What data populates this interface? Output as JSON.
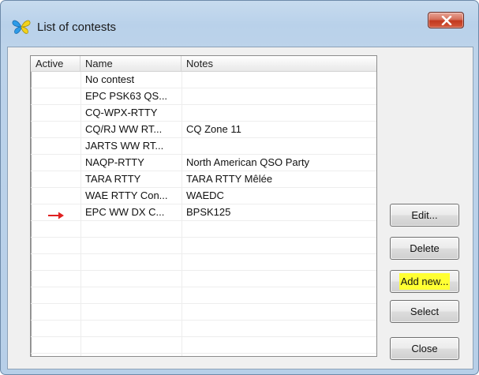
{
  "window": {
    "title": "List of contests",
    "icon": "butterfly-icon",
    "close_icon": "close-icon"
  },
  "list": {
    "columns": [
      "Active",
      "Name",
      "Notes"
    ],
    "rows": [
      {
        "active": "",
        "name": "No contest",
        "notes": ""
      },
      {
        "active": "",
        "name": "EPC PSK63 QS...",
        "notes": ""
      },
      {
        "active": "",
        "name": "CQ-WPX-RTTY",
        "notes": ""
      },
      {
        "active": "",
        "name": "CQ/RJ WW RT...",
        "notes": "CQ Zone 11"
      },
      {
        "active": "",
        "name": "JARTS WW RT...",
        "notes": ""
      },
      {
        "active": "",
        "name": "NAQP-RTTY",
        "notes": "North American QSO Party"
      },
      {
        "active": "",
        "name": "TARA RTTY",
        "notes": "TARA RTTY Mêlée"
      },
      {
        "active": "",
        "name": "WAE RTTY Con...",
        "notes": "WAEDC"
      },
      {
        "active": "arrow-icon",
        "name": "EPC WW DX C...",
        "notes": "BPSK125"
      }
    ],
    "empty_rows": 8
  },
  "buttons": {
    "edit": "Edit...",
    "delete": "Delete",
    "add_new": "Add new...",
    "select": "Select",
    "close": "Close"
  },
  "colors": {
    "highlight": "#ffff33",
    "arrow": "#e02020",
    "close_button": "#c9452b"
  }
}
